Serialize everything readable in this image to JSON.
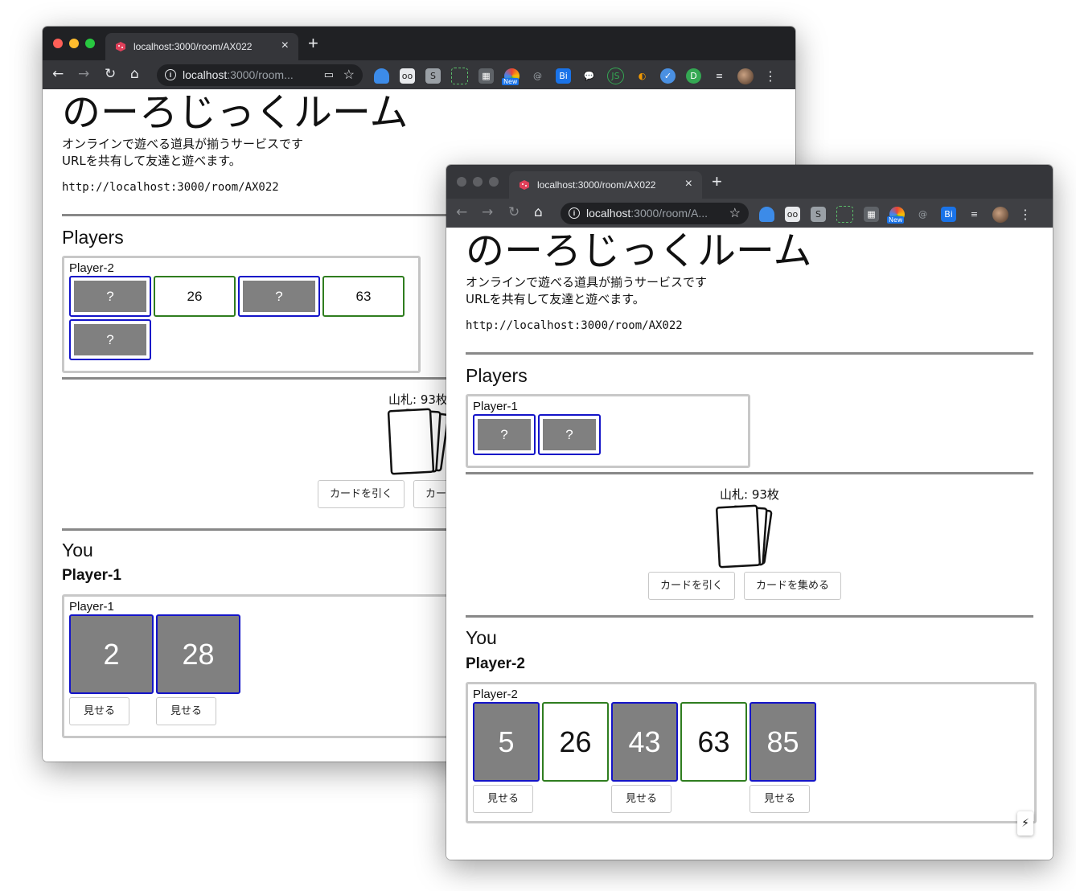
{
  "browser": {
    "tab_title": "localhost:3000/room/AX022",
    "new_tab": "+",
    "url_host": "localhost",
    "url_path_win1": ":3000/room...",
    "url_path_win2": ":3000/room/A...",
    "extension_new_badge": "New"
  },
  "page": {
    "title": "のーろじっくルーム",
    "tagline_1": "オンラインで遊べる道具が揃うサービスです",
    "tagline_2": "URLを共有して友達と遊べます。",
    "room_url": "http://localhost:3000/room/AX022",
    "players_heading": "Players",
    "you_heading": "You",
    "deck_count": "山札: 93枚",
    "draw_button": "カードを引く",
    "collect_button": "カードを集める",
    "show_button": "見せる",
    "hidden_card": "?"
  },
  "window1": {
    "other_player": "Player-2",
    "other_cards": [
      {
        "value": "?",
        "open": false
      },
      {
        "value": "26",
        "open": true
      },
      {
        "value": "?",
        "open": false
      },
      {
        "value": "63",
        "open": true
      },
      {
        "value": "?",
        "open": false
      }
    ],
    "self_name": "Player-1",
    "self_cards": [
      {
        "value": "2",
        "open": false
      },
      {
        "value": "28",
        "open": false
      }
    ],
    "collect_button_partial": "カー",
    "deck_count_partial": "山札: 93枚"
  },
  "window2": {
    "other_player": "Player-1",
    "other_cards": [
      {
        "value": "?",
        "open": false
      },
      {
        "value": "?",
        "open": false
      }
    ],
    "self_name": "Player-2",
    "self_cards": [
      {
        "value": "5",
        "open": false
      },
      {
        "value": "26",
        "open": true
      },
      {
        "value": "43",
        "open": false
      },
      {
        "value": "63",
        "open": true
      },
      {
        "value": "85",
        "open": false
      }
    ]
  },
  "colors": {
    "hidden_card_border": "#1414c8",
    "open_card_border": "#2f7d1f",
    "hidden_card_fill": "#808080"
  }
}
